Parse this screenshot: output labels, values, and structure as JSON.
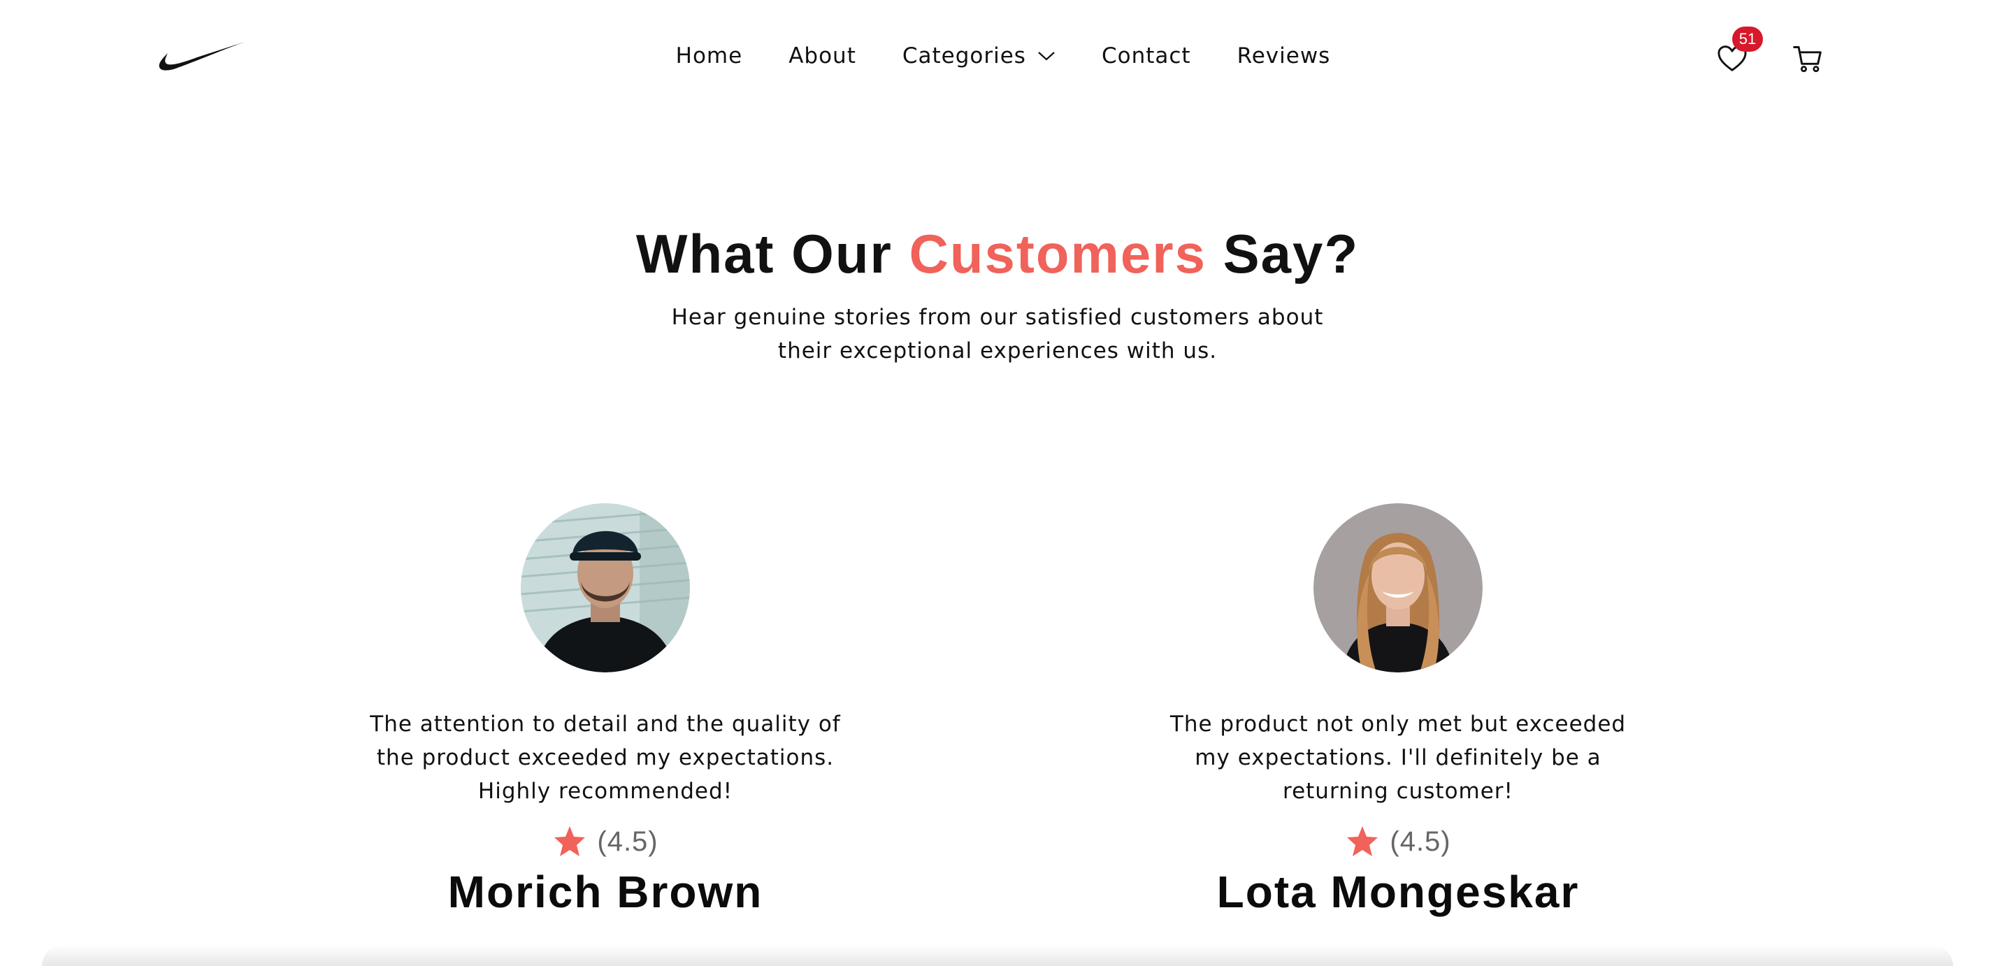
{
  "brand": {
    "logo_icon": "swoosh-logo-icon"
  },
  "nav": {
    "links": [
      {
        "label": "Home"
      },
      {
        "label": "About"
      },
      {
        "label": "Categories"
      },
      {
        "label": "Contact"
      },
      {
        "label": "Reviews"
      }
    ],
    "wishlist_count": "51"
  },
  "section": {
    "title_part1": "What Our ",
    "title_accent": "Customers",
    "title_part2": " Say?",
    "subtitle": "Hear genuine stories from our satisfied customers about their exceptional experiences with us."
  },
  "testimonials": [
    {
      "quote": "The attention to detail and the quality of the product exceeded my expectations. Highly recommended!",
      "rating": "(4.5)",
      "name": "Morich Brown"
    },
    {
      "quote": "The product not only met but exceeded my expectations. I'll definitely be a returning customer!",
      "rating": "(4.5)",
      "name": "Lota Mongeskar"
    }
  ],
  "colors": {
    "accent": "#f0625a",
    "badge": "#d6192b",
    "text": "#111111",
    "muted": "#666666"
  }
}
